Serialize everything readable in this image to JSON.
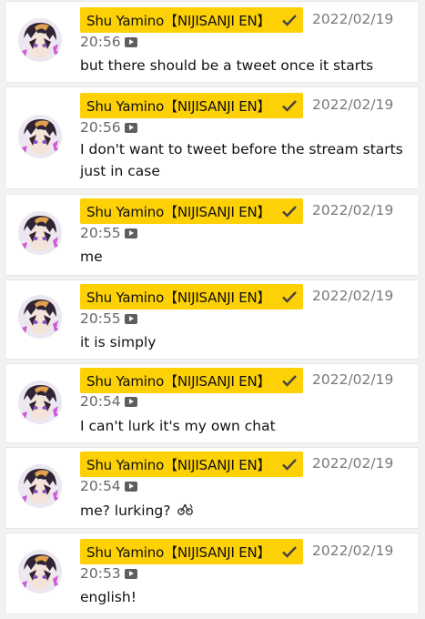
{
  "colors": {
    "background": "#f2f2f2",
    "card": "#ffffff",
    "author_badge": "#fdd105",
    "date_text": "#7a7a7a"
  },
  "messages": [
    {
      "author": "Shu Yamino【NIJISANJI EN】",
      "date": "2022/02/19",
      "time": "20:56",
      "text": "but there should be a tweet once it starts",
      "icons": [
        "verified-check-icon",
        "video-icon"
      ]
    },
    {
      "author": "Shu Yamino【NIJISANJI EN】",
      "date": "2022/02/19",
      "time": "20:56",
      "text": "I don't want to tweet before the stream starts just in case",
      "icons": [
        "verified-check-icon",
        "video-icon"
      ]
    },
    {
      "author": "Shu Yamino【NIJISANJI EN】",
      "date": "2022/02/19",
      "time": "20:55",
      "text": "me",
      "icons": [
        "verified-check-icon",
        "video-icon"
      ]
    },
    {
      "author": "Shu Yamino【NIJISANJI EN】",
      "date": "2022/02/19",
      "time": "20:55",
      "text": "it is simply",
      "icons": [
        "verified-check-icon",
        "video-icon"
      ]
    },
    {
      "author": "Shu Yamino【NIJISANJI EN】",
      "date": "2022/02/19",
      "time": "20:54",
      "text": "I can't lurk it's my own chat",
      "icons": [
        "verified-check-icon",
        "video-icon"
      ]
    },
    {
      "author": "Shu Yamino【NIJISANJI EN】",
      "date": "2022/02/19",
      "time": "20:54",
      "text": "me? lurking?",
      "icons": [
        "verified-check-icon",
        "video-icon",
        "custom-emoji-icon"
      ]
    },
    {
      "author": "Shu Yamino【NIJISANJI EN】",
      "date": "2022/02/19",
      "time": "20:53",
      "text": "english!",
      "icons": [
        "verified-check-icon",
        "video-icon"
      ]
    }
  ]
}
